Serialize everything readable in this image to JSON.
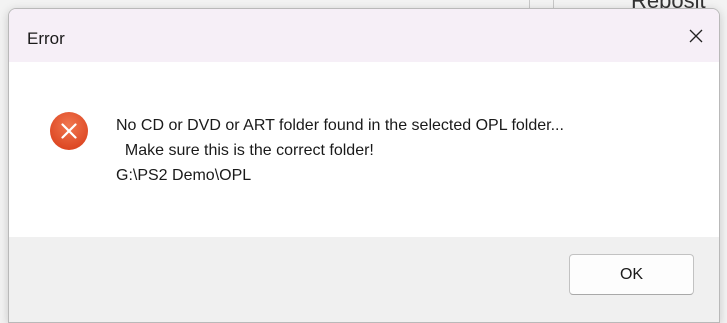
{
  "background_window": {
    "partial_text": "Reposit"
  },
  "dialog": {
    "title": "Error",
    "close_icon": "close-icon",
    "status_icon": "error-icon",
    "status_color": "#e8502b",
    "message_lines": [
      "No CD or DVD or ART folder found in the selected OPL folder...",
      "  Make sure this is the correct folder!",
      "G:\\PS2 Demo\\OPL"
    ],
    "buttons": {
      "ok_label": "OK"
    }
  }
}
